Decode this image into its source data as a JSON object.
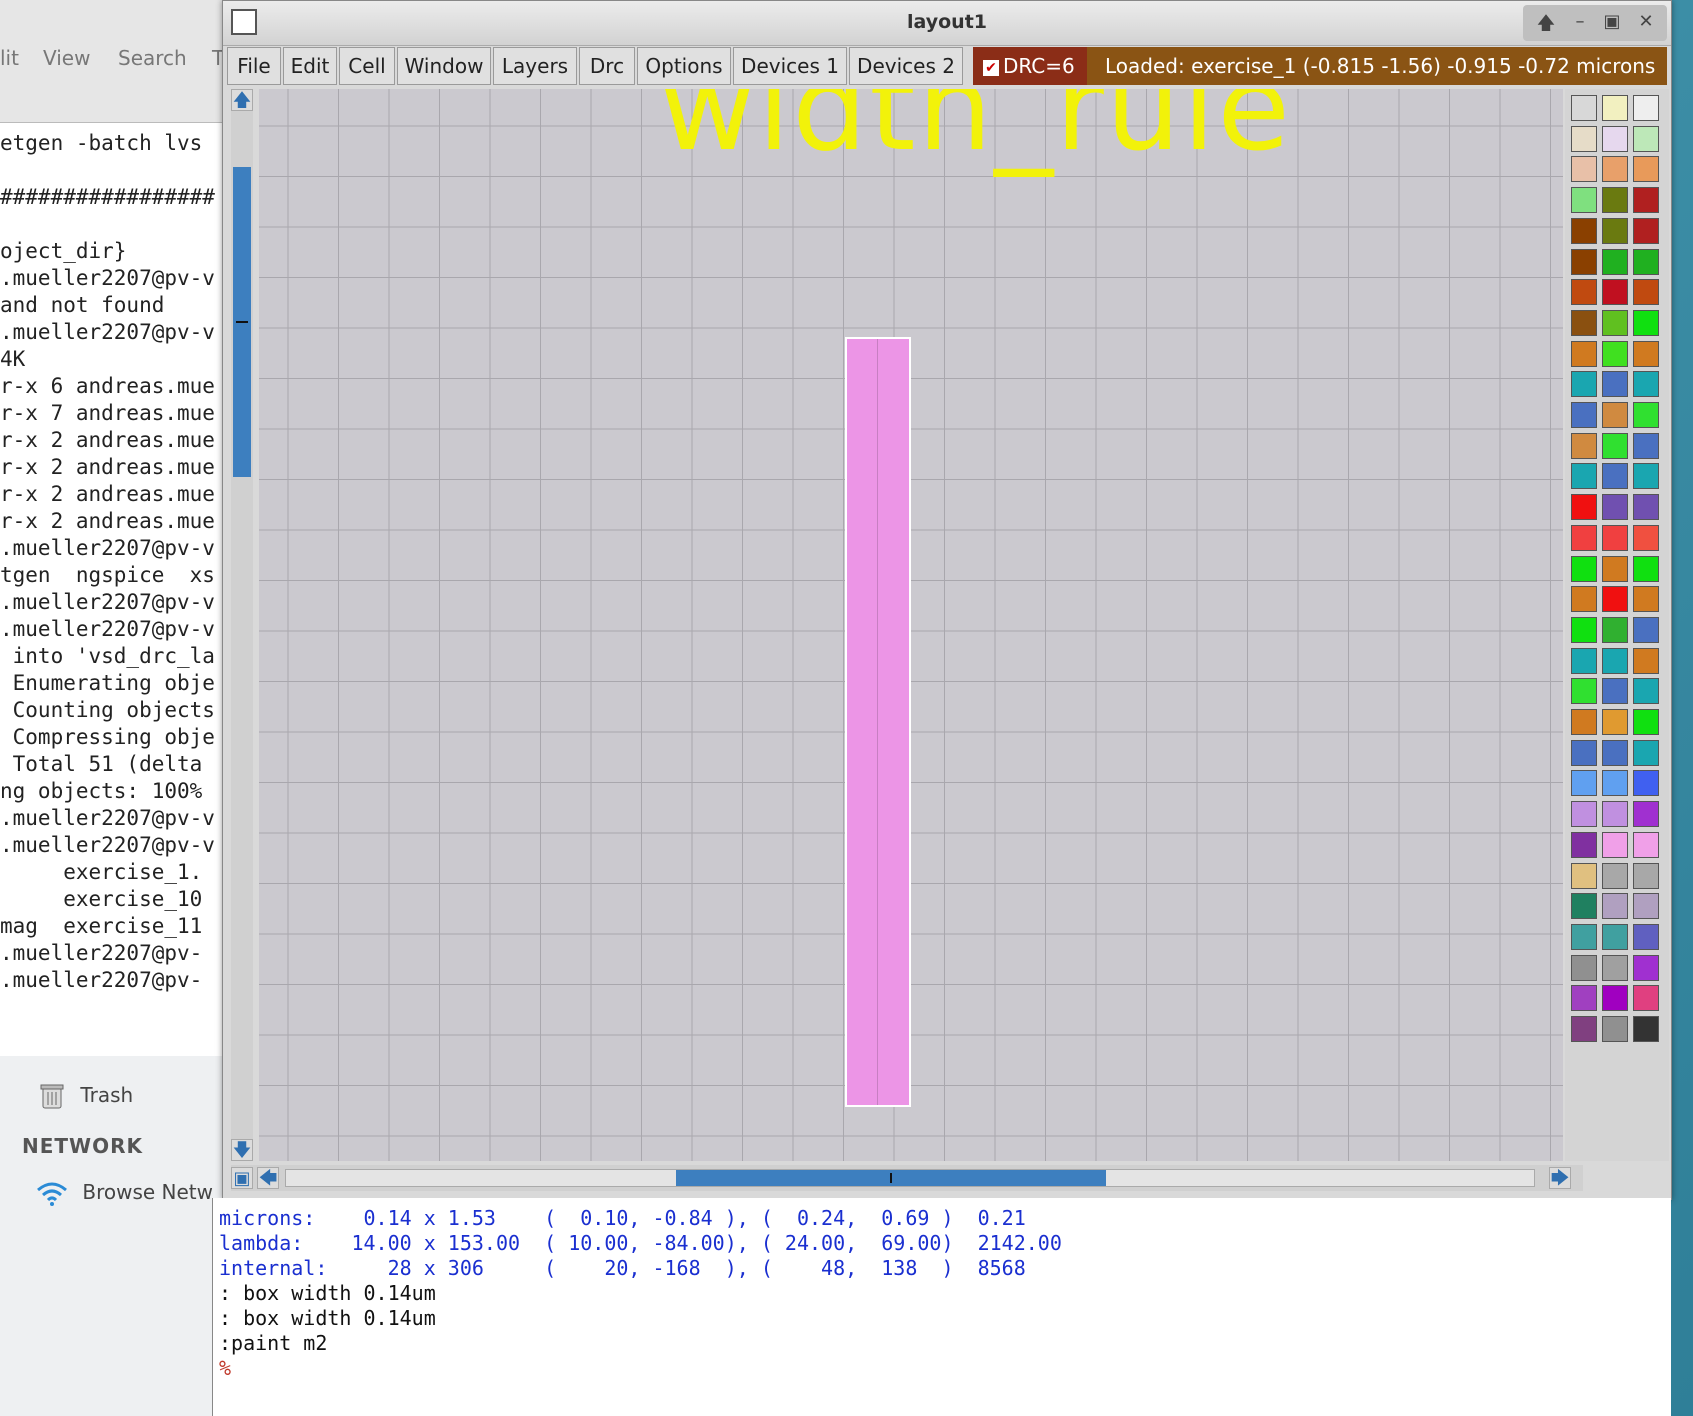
{
  "terminal": {
    "menu": [
      "lit",
      "View",
      "Search",
      "T"
    ],
    "lines": [
      "etgen -batch lvs",
      "",
      "#################",
      "",
      "oject_dir}",
      ".mueller2207@pv-v",
      "and not found",
      ".mueller2207@pv-v",
      "4K",
      "r-x 6 andreas.mue",
      "r-x 7 andreas.mue",
      "r-x 2 andreas.mue",
      "r-x 2 andreas.mue",
      "r-x 2 andreas.mue",
      "r-x 2 andreas.mue",
      ".mueller2207@pv-v",
      "tgen  ngspice  xs",
      ".mueller2207@pv-v",
      ".mueller2207@pv-v",
      " into 'vsd_drc_la",
      " Enumerating obje",
      " Counting objects",
      " Compressing obje",
      " Total 51 (delta ",
      "ng objects: 100%",
      ".mueller2207@pv-v",
      ".mueller2207@pv-v",
      "     exercise_1.",
      "     exercise_10",
      "mag  exercise_11",
      ".mueller2207@pv-",
      ".mueller2207@pv-"
    ]
  },
  "file_manager": {
    "trash": "Trash",
    "network_heading": "NETWORK",
    "browse_network": "Browse Netw"
  },
  "magic": {
    "title": "layout1",
    "menu": [
      "File",
      "Edit",
      "Cell",
      "Window",
      "Layers",
      "Drc",
      "Options",
      "Devices 1",
      "Devices 2"
    ],
    "drc_label": "DRC=6",
    "drc_checked": true,
    "status": "Loaded: exercise_1   (-0.815 -1.56) -0.915 -0.72 microns",
    "canvas_label": "width_rule",
    "layer_color": "#ec95e6",
    "label_color": "#f2f20a"
  },
  "console": {
    "lines": [
      {
        "text": "microns:    0.14 x 1.53    (  0.10, -0.84 ), (  0.24,  0.69 )  0.21",
        "style": "blue"
      },
      {
        "text": "lambda:    14.00 x 153.00  ( 10.00, -84.00), ( 24.00,  69.00)  2142.00",
        "style": "blue"
      },
      {
        "text": "internal:     28 x 306     (    20, -168  ), (    48,  138  )  8568",
        "style": "blue"
      },
      {
        "text": ": box width 0.14um",
        "style": "dark"
      },
      {
        "text": ": box width 0.14um",
        "style": "dark"
      },
      {
        "text": ":paint m2",
        "style": "dark"
      },
      {
        "text": "%",
        "style": "prompt"
      }
    ]
  }
}
